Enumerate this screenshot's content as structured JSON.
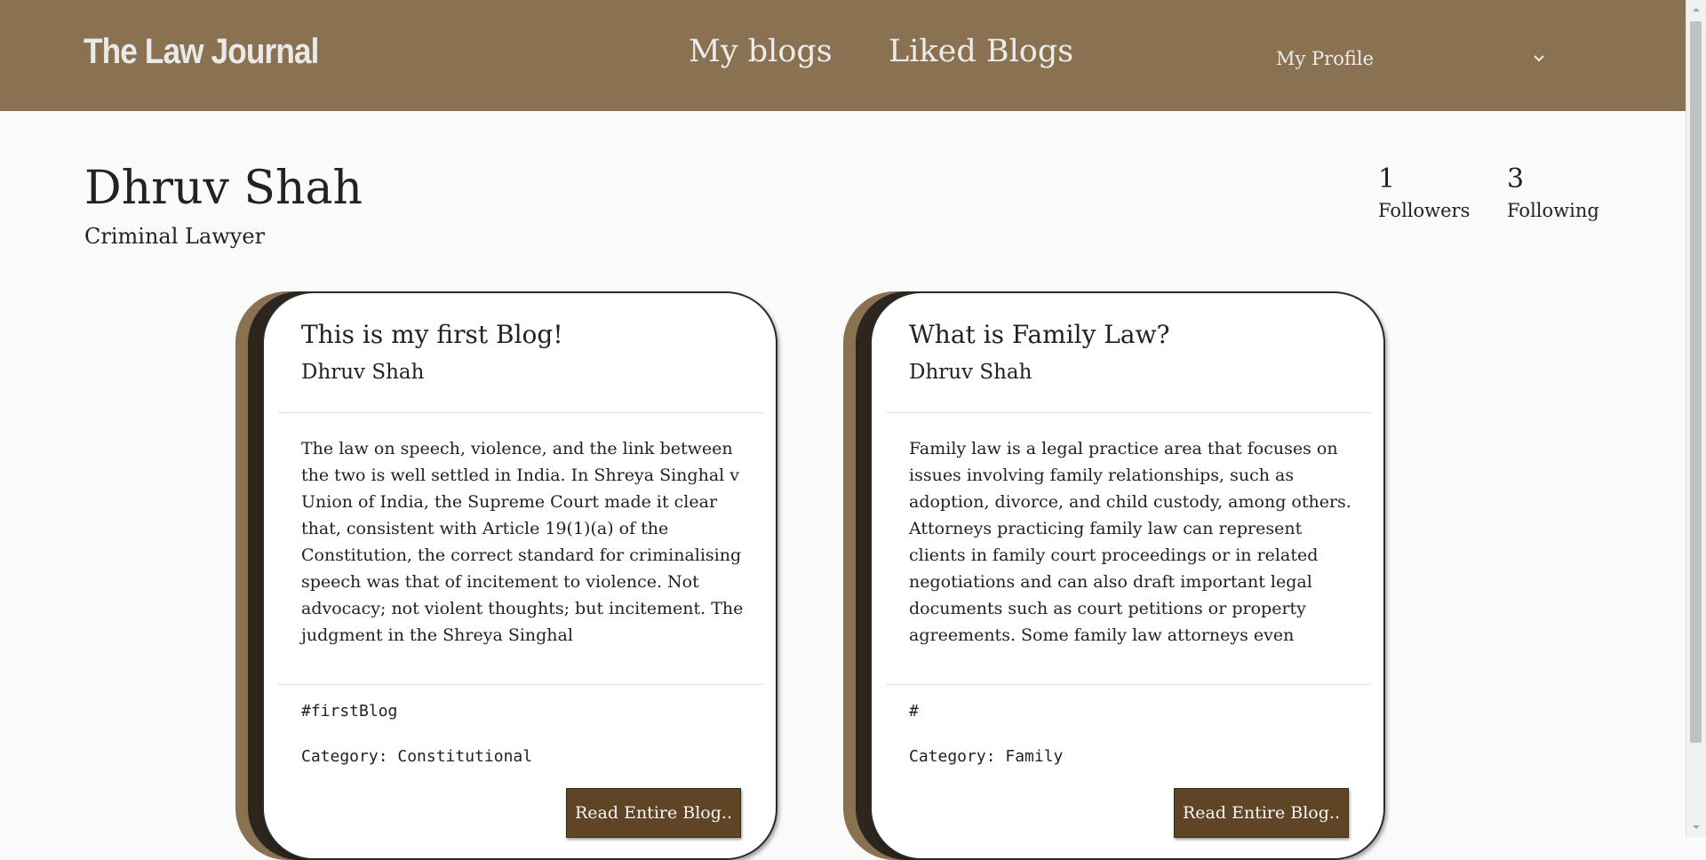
{
  "nav": {
    "brand": "The Law Journal",
    "links": [
      {
        "label": "My blogs"
      },
      {
        "label": "Liked Blogs"
      }
    ],
    "profile_menu_label": "My Profile"
  },
  "profile": {
    "name": "Dhruv Shah",
    "title": "Criminal Lawyer",
    "followers_count": "1",
    "followers_label": "Followers",
    "following_count": "3",
    "following_label": "Following"
  },
  "blogs": [
    {
      "title": "This is my first Blog!",
      "author": "Dhruv Shah",
      "excerpt": "The law on speech, violence, and the link between the two is well settled in India. In Shreya Singhal v Union of India, the Supreme Court made it clear that, consistent with Article 19(1)(a) of the Constitution, the correct standard for criminalising speech was that of incitement to violence. Not advocacy; not violent thoughts; but incitement. The judgment in the Shreya Singhal",
      "tags": "#firstBlog",
      "category": "Category: Constitutional",
      "button_label": "Read Entire Blog.."
    },
    {
      "title": "What is Family Law?",
      "author": "Dhruv Shah",
      "excerpt": "Family law is a legal practice area that focuses on issues involving family relationships, such as adoption, divorce, and child custody, among others. Attorneys practicing family law can represent clients in family court proceedings or in related negotiations and can also draft important legal documents such as court petitions or property agreements. Some family law attorneys even",
      "tags": "#",
      "category": "Category: Family",
      "button_label": "Read Entire Blog.."
    }
  ],
  "colors": {
    "navbar": "#8a7152",
    "card_accent_dark": "#2d261e",
    "button": "#5f4526"
  }
}
